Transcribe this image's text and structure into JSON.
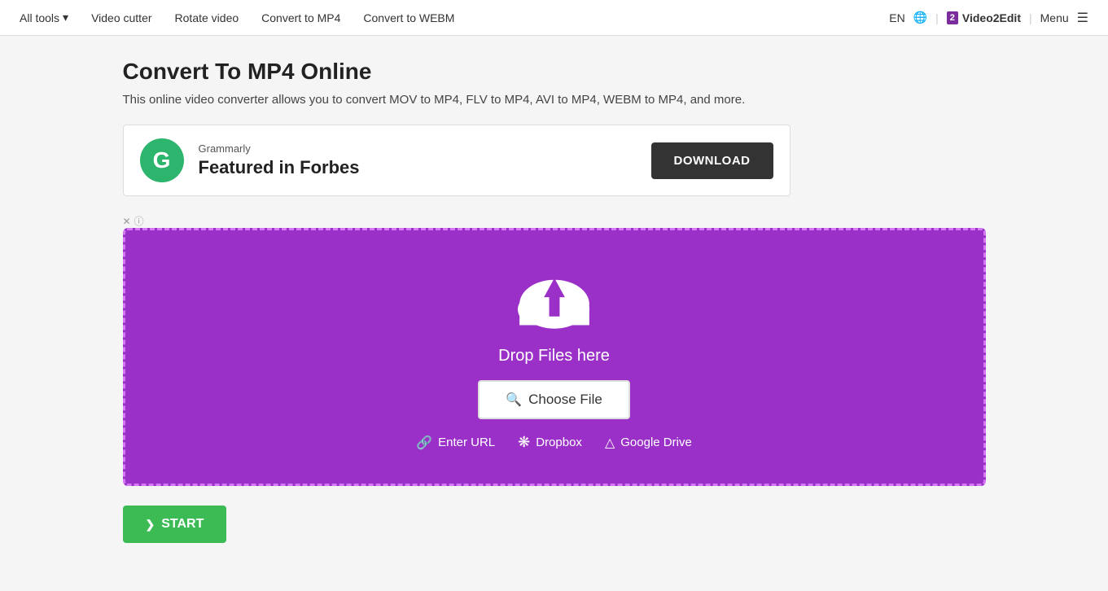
{
  "navbar": {
    "all_tools_label": "All tools",
    "chevron": "▾",
    "nav_items": [
      {
        "label": "Video cutter"
      },
      {
        "label": "Rotate video"
      },
      {
        "label": "Convert to MP4"
      },
      {
        "label": "Convert to WEBM"
      }
    ],
    "lang": "EN",
    "globe_icon": "🌐",
    "separator": "|",
    "brand_logo_box": "2",
    "brand_name": "Video2Edit",
    "menu_label": "Menu",
    "menu_icon": "☰"
  },
  "main": {
    "page_title": "Convert To MP4 Online",
    "page_subtitle": "This online video converter allows you to convert MOV to MP4, FLV to MP4, AVI to MP4, WEBM to MP4, and more."
  },
  "ad": {
    "logo_letter": "G",
    "brand_name": "Grammarly",
    "headline": "Featured in Forbes",
    "download_btn_label": "DOWNLOAD",
    "close_label": "✕",
    "info_label": "ⓘ"
  },
  "drop_zone": {
    "drop_text": "Drop Files here",
    "choose_file_label": "Choose File",
    "search_icon": "🔍",
    "link_url": "Enter URL",
    "link_url_icon": "🔗",
    "link_dropbox": "Dropbox",
    "link_dropbox_icon": "❋",
    "link_google": "Google Drive",
    "link_google_icon": "△"
  },
  "start_button": {
    "label": "START",
    "arrow": "❯"
  }
}
